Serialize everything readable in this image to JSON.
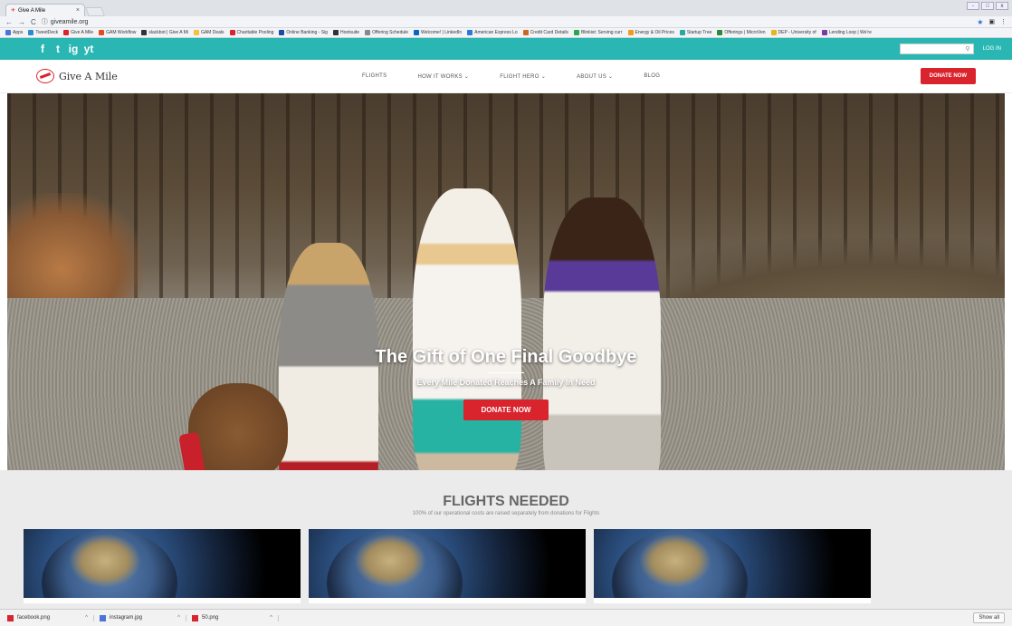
{
  "browser": {
    "tab_title": "Give A Mile",
    "tab_close": "×",
    "url": "giveamile.org",
    "nav_back": "←",
    "nav_forward": "→",
    "nav_reload": "C",
    "win_min": "-",
    "win_max": "□",
    "win_close": "x",
    "bookmarks": [
      {
        "label": "Apps",
        "color": "#4a74d8"
      },
      {
        "label": "TweetDeck",
        "color": "#2a8bd8"
      },
      {
        "label": "Give A Mile",
        "color": "#d9232d"
      },
      {
        "label": "GAM Workflow",
        "color": "#e84a1f"
      },
      {
        "label": "slackbot | Give A Mi",
        "color": "#333"
      },
      {
        "label": "GAM Deals",
        "color": "#f6c23e"
      },
      {
        "label": "Charitable Pooling",
        "color": "#d9232d"
      },
      {
        "label": "Online Banking - Sig",
        "color": "#1b4aa8"
      },
      {
        "label": "Hootsuite",
        "color": "#333"
      },
      {
        "label": "Offering Schedule",
        "color": "#888"
      },
      {
        "label": "Welcome! | LinkedIn",
        "color": "#0b66c2"
      },
      {
        "label": "American Express Lo",
        "color": "#2a7ad8"
      },
      {
        "label": "Credit Card Details",
        "color": "#c62"
      },
      {
        "label": "Blinkist: Serving curr",
        "color": "#2aa84a"
      },
      {
        "label": "Energy & Oil Prices",
        "color": "#f29a1f"
      },
      {
        "label": "Startup Tree",
        "color": "#2aa8a0"
      },
      {
        "label": "Offerings | MicroVen",
        "color": "#2a8a3a"
      },
      {
        "label": "DEP - University of",
        "color": "#e8b41f"
      },
      {
        "label": "Lending Loop | We're",
        "color": "#7a3aa8"
      }
    ]
  },
  "topbar": {
    "social_icons": [
      "f",
      "t",
      "ig",
      "yt"
    ],
    "login": "LOG IN",
    "search_icon": "⚲"
  },
  "nav": {
    "logo": "Give A Mile",
    "menu": [
      "FLIGHTS",
      "HOW IT WORKS ⌄",
      "FLIGHT HERO ⌄",
      "ABOUT US ⌄",
      "BLOG"
    ],
    "donate": "DONATE NOW"
  },
  "hero": {
    "title": "The Gift of One Final Goodbye",
    "subtitle": "Every Mile Donated Reaches A Family In Need",
    "donate": "DONATE NOW"
  },
  "flights": {
    "title": "FLIGHTS NEEDED",
    "subtitle": "100% of our operational costs are raised separately from donations for Flights"
  },
  "downloads": {
    "items": [
      "facebook.png",
      "instagram.jpg",
      "50.png"
    ],
    "show_all": "Show all"
  }
}
